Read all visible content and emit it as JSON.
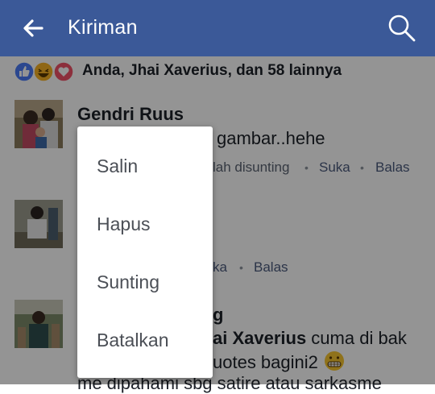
{
  "appbar": {
    "title": "Kiriman",
    "color": "#3b5998"
  },
  "reactions": {
    "icons": [
      "like-icon",
      "haha-icon",
      "love-icon"
    ],
    "summary": "Anda, Jhai Xaverius, dan 58 lainnya"
  },
  "comments": [
    {
      "name": "Gendri Ruus",
      "text_visible": "gambar..hehe",
      "meta": "lah disunting",
      "like_label": "Suka",
      "reply_label": "Balas"
    },
    {
      "reply_partial": "ka",
      "reply_label": "Balas"
    },
    {
      "name_partial": "g",
      "line1_bold": "ai Xaverius",
      "line1_rest": " cuma di bak",
      "line2": "uotes bagini2",
      "line3": "me dipahami sbg satire atau sarkasme"
    }
  ],
  "context_menu": {
    "items": [
      "Salin",
      "Hapus",
      "Sunting",
      "Batalkan"
    ]
  }
}
